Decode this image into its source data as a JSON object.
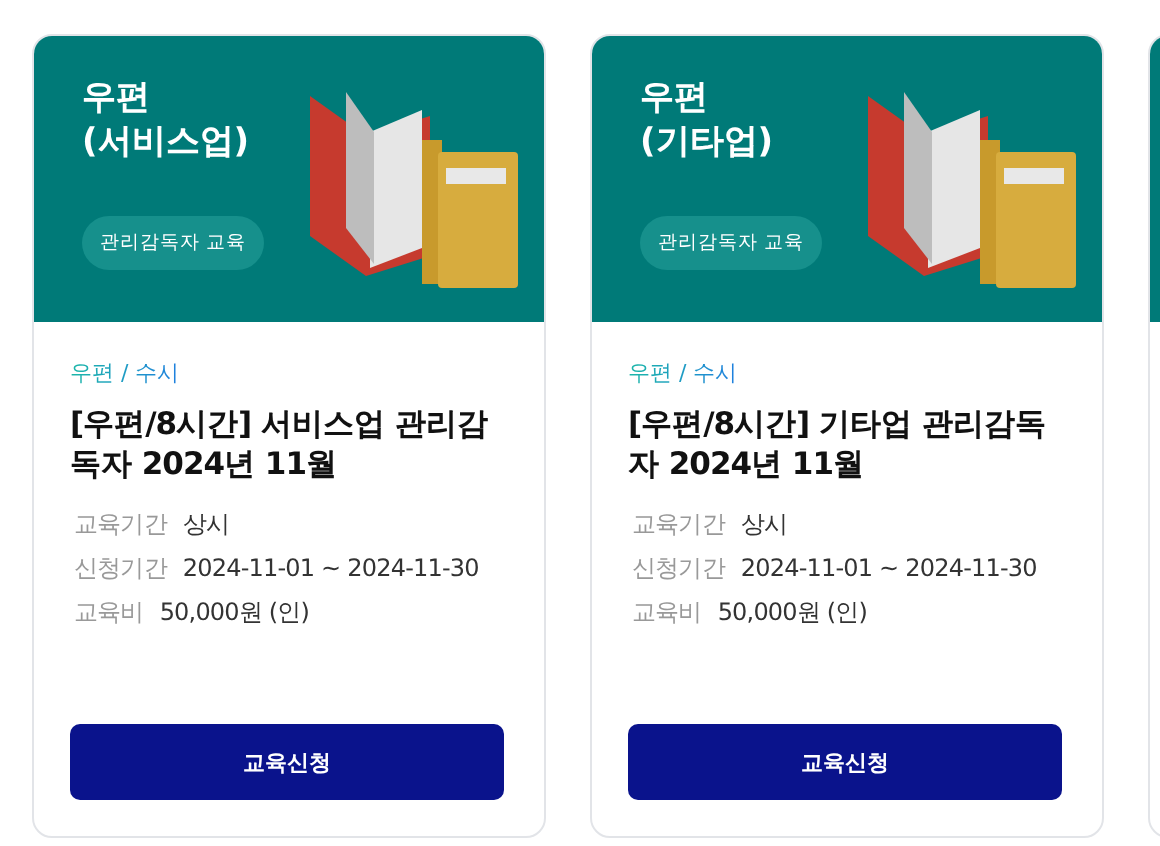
{
  "cards": [
    {
      "header_title": [
        "우편",
        "(서비스업)"
      ],
      "badge": "관리감독자 교육",
      "category": "우편 / 수시",
      "title": "[우편/8시간] 서비스업 관리감독자 2024년 11월",
      "info": [
        {
          "label": "교육기간",
          "value": "상시"
        },
        {
          "label": "신청기간",
          "value": "2024-11-01 ~ 2024-11-30"
        },
        {
          "label": "교육비",
          "value": "50,000원 (인)"
        }
      ],
      "button": "교육신청"
    },
    {
      "header_title": [
        "우편",
        "(기타업)"
      ],
      "badge": "관리감독자 교육",
      "category": "우편 / 수시",
      "title": "[우편/8시간] 기타업 관리감독자 2024년 11월",
      "info": [
        {
          "label": "교육기간",
          "value": "상시"
        },
        {
          "label": "신청기간",
          "value": "2024-11-01 ~ 2024-11-30"
        },
        {
          "label": "교육비",
          "value": "50,000원 (인)"
        }
      ],
      "button": "교육신청"
    }
  ]
}
